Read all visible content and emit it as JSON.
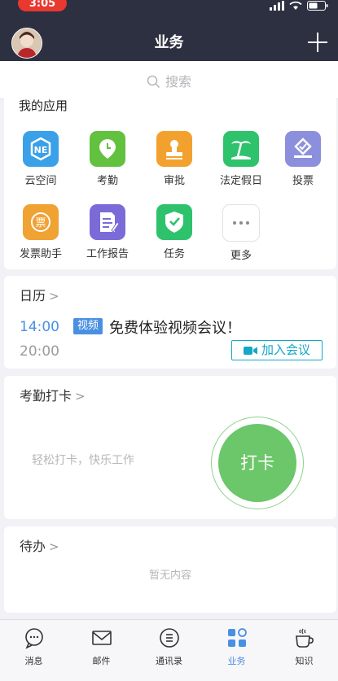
{
  "status_bar": {
    "time": "3:05"
  },
  "header": {
    "title": "业务"
  },
  "search": {
    "placeholder": "搜索"
  },
  "my_apps": {
    "title": "我的应用",
    "items": [
      {
        "label": "云空间",
        "icon": "cloud-space-icon",
        "color": "#3aa0e8"
      },
      {
        "label": "考勤",
        "icon": "attendance-clock-icon",
        "color": "#62c13f"
      },
      {
        "label": "审批",
        "icon": "approval-stamp-icon",
        "color": "#f3a12e"
      },
      {
        "label": "法定假日",
        "icon": "holiday-palm-icon",
        "color": "#2fc26c"
      },
      {
        "label": "投票",
        "icon": "vote-icon",
        "color": "#8c8fdc"
      },
      {
        "label": "发票助手",
        "icon": "invoice-icon",
        "color": "#f0a233"
      },
      {
        "label": "工作报告",
        "icon": "work-report-icon",
        "color": "#7b6bd8"
      },
      {
        "label": "任务",
        "icon": "task-check-icon",
        "color": "#2fc26c"
      },
      {
        "label": "更多",
        "icon": "more-dots-icon",
        "color": "#ffffff"
      }
    ]
  },
  "calendar": {
    "title": "日历",
    "event": {
      "start": "14:00",
      "end": "20:00",
      "tag": "视频",
      "text": "免费体验视频会议！",
      "join_label": "加入会议"
    }
  },
  "attendance": {
    "title": "考勤打卡",
    "subtitle": "轻松打卡，快乐工作",
    "button": "打卡"
  },
  "todo": {
    "title": "待办",
    "empty": "暂无内容"
  },
  "tabs": [
    {
      "label": "消息",
      "icon": "message-bubble-icon",
      "active": false
    },
    {
      "label": "邮件",
      "icon": "mail-icon",
      "active": false
    },
    {
      "label": "通讯录",
      "icon": "contacts-icon",
      "active": false
    },
    {
      "label": "业务",
      "icon": "business-grid-icon",
      "active": true
    },
    {
      "label": "知识",
      "icon": "coffee-cup-icon",
      "active": false
    }
  ],
  "colors": {
    "accent": "#4a90e2",
    "nav_bg": "#2d3040",
    "punch_green": "#6cc66a"
  }
}
